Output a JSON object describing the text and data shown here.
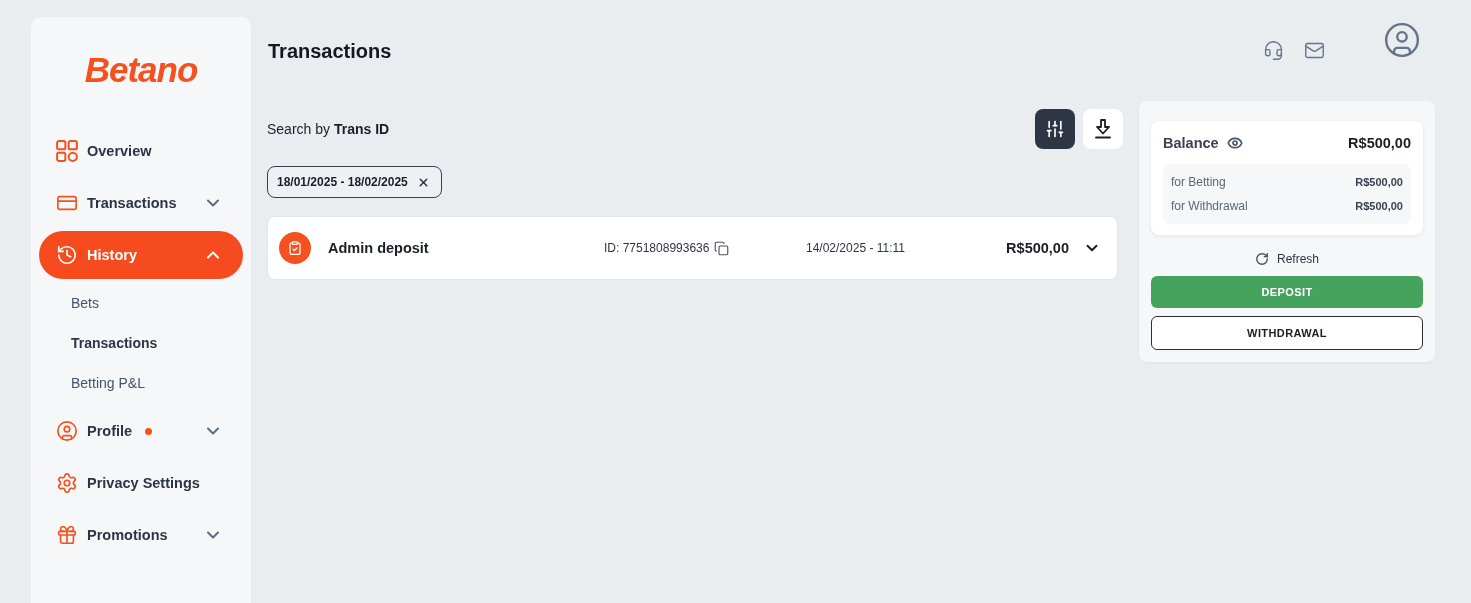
{
  "sidebar": {
    "logo": "Betano",
    "items": [
      {
        "kind": "link",
        "label": "Overview",
        "selected": false,
        "notification": false
      },
      {
        "kind": "group",
        "label": "Transactions",
        "selected": false,
        "notification": false,
        "expanded": false
      },
      {
        "kind": "group",
        "label": "History",
        "selected": true,
        "notification": false,
        "expanded": true,
        "children": [
          {
            "label": "Bets",
            "selected": false
          },
          {
            "label": "Transactions",
            "selected": true
          },
          {
            "label": "Betting P&L",
            "selected": false
          }
        ]
      },
      {
        "kind": "group",
        "label": "Profile",
        "selected": false,
        "notification": true,
        "expanded": false
      },
      {
        "kind": "link",
        "label": "Privacy Settings",
        "selected": false,
        "notification": false
      },
      {
        "kind": "group",
        "label": "Promotions",
        "selected": false,
        "notification": false,
        "expanded": false
      }
    ]
  },
  "header": {
    "title": "Transactions"
  },
  "search": {
    "label": "Search by **Trans ID**"
  },
  "toolbar": {
    "filter_on": true
  },
  "filters": [
    {
      "label": "18/01/2025 - 18/02/2025"
    }
  ],
  "transactions": [
    {
      "title": "Admin deposit",
      "id": "ID: 7751808993636",
      "date": "14/02/2025 - 11:11",
      "amount": "R$500,00",
      "expanded": false
    }
  ],
  "balance": {
    "label": "Balance",
    "amount": "R$500,00",
    "breakdown": [
      {
        "label": "for Betting",
        "amount": "R$500,00"
      },
      {
        "label": "for Withdrawal",
        "amount": "R$500,00"
      }
    ],
    "refresh": "Refresh",
    "buttons": [
      {
        "kind": "primary",
        "label": "DEPOSIT"
      },
      {
        "kind": "outline",
        "label": "WITHDRAWAL"
      }
    ]
  }
}
